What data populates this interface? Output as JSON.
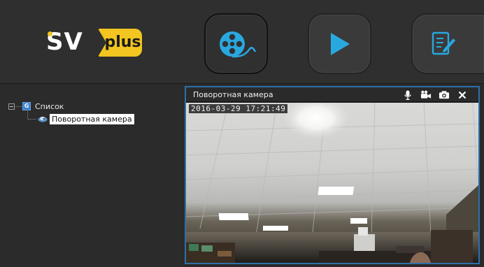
{
  "logo": {
    "left_text": "SV",
    "right_text": "plus",
    "accent_color": "#f2c520"
  },
  "toolbar": {
    "buttons": [
      {
        "name": "archive",
        "icon": "film-reel-icon",
        "active": true
      },
      {
        "name": "play",
        "icon": "play-icon",
        "active": false
      },
      {
        "name": "report",
        "icon": "report-edit-icon",
        "active": false
      }
    ],
    "icon_color": "#29a8e0"
  },
  "tree": {
    "root_label": "Список",
    "root_icon_letter": "G",
    "child_label": "Поворотная камера"
  },
  "video": {
    "title": "Поворотная камера",
    "timestamp": "2016-03-29   17:21:49",
    "border_color": "#2f6fa8",
    "controls": [
      "microphone-icon",
      "video-camera-icon",
      "camera-snapshot-icon",
      "close-icon"
    ]
  }
}
